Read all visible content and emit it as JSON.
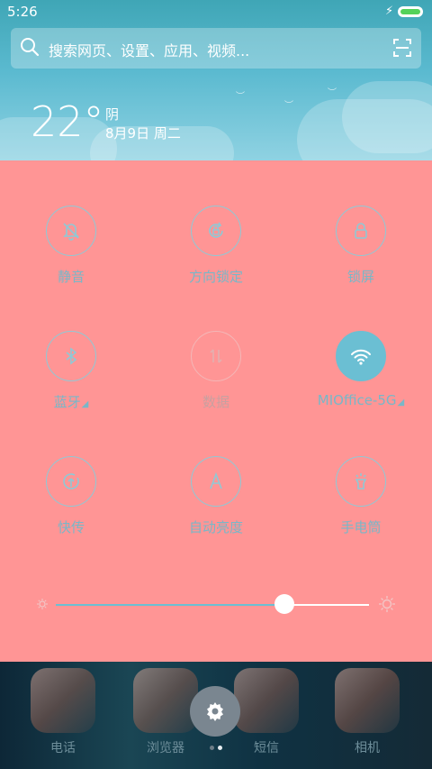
{
  "status": {
    "time": "5:26",
    "battery_level": 1.0
  },
  "search": {
    "placeholder": "搜索网页、设置、应用、视频..."
  },
  "weather": {
    "temperature": "22°",
    "condition": "阴",
    "date": "8月9日 周二"
  },
  "toggles": [
    {
      "label": "静音",
      "icon": "bell-off-icon",
      "active": false
    },
    {
      "label": "方向锁定",
      "icon": "rotation-lock-icon",
      "active": false
    },
    {
      "label": "锁屏",
      "icon": "lock-icon",
      "active": false
    },
    {
      "label": "蓝牙",
      "icon": "bluetooth-icon",
      "active": false
    },
    {
      "label": "数据",
      "icon": "data-icon",
      "active": false
    },
    {
      "label": "MIOffice-5G",
      "icon": "wifi-icon",
      "active": true
    },
    {
      "label": "快传",
      "icon": "share-icon",
      "active": false
    },
    {
      "label": "自动亮度",
      "icon": "auto-brightness-icon",
      "active": false
    },
    {
      "label": "手电筒",
      "icon": "flashlight-icon",
      "active": false
    }
  ],
  "brightness": {
    "value": 0.73
  },
  "dock": [
    {
      "label": "电话"
    },
    {
      "label": "浏览器"
    },
    {
      "label": "短信"
    },
    {
      "label": "相机"
    }
  ],
  "colors": {
    "panel": "#ff9595",
    "accent": "#6bbfd3",
    "sky": "#5bbad0"
  }
}
